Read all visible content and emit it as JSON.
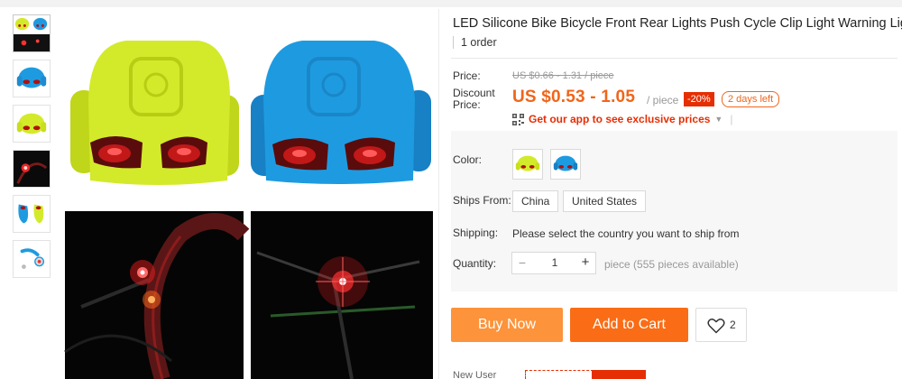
{
  "product": {
    "title": "LED Silicone Bike Bicycle Front Rear Lights Push Cycle Clip Light Warning Light",
    "orders": "1 order"
  },
  "thumbnails": [
    {
      "name": "thumb-yellow-blue"
    },
    {
      "name": "thumb-blue"
    },
    {
      "name": "thumb-yellow"
    },
    {
      "name": "thumb-night-red"
    },
    {
      "name": "thumb-pair-side"
    },
    {
      "name": "thumb-parts"
    }
  ],
  "price": {
    "price_label": "Price:",
    "original": "US $0.66 - 1.31 / piece",
    "discount_label_line1": "Discount",
    "discount_label_line2": "Price:",
    "current": "US $0.53 - 1.05",
    "unit": "/ piece",
    "off_badge": "-20%",
    "days_left": "2 days left",
    "app_promo": "Get our app to see exclusive prices"
  },
  "options": {
    "color_label": "Color:",
    "ships_from_label": "Ships From:",
    "ships_from": [
      "China",
      "United States"
    ],
    "shipping_label": "Shipping:",
    "shipping_text": "Please select the country you want to ship from",
    "quantity_label": "Quantity:",
    "quantity_value": "1",
    "quantity_available": "piece (555 pieces available)"
  },
  "actions": {
    "buy_now": "Buy Now",
    "add_to_cart": "Add to Cart",
    "wish_count": "2"
  },
  "footer": {
    "new_user": "New User"
  },
  "colors": {
    "accent_orange": "#fa6d16",
    "buy_orange": "#fd933a",
    "price_orange": "#f0651a",
    "badge_red": "#e62e04",
    "light_yellow": "#d3ea2a",
    "light_blue": "#1e9be0"
  }
}
